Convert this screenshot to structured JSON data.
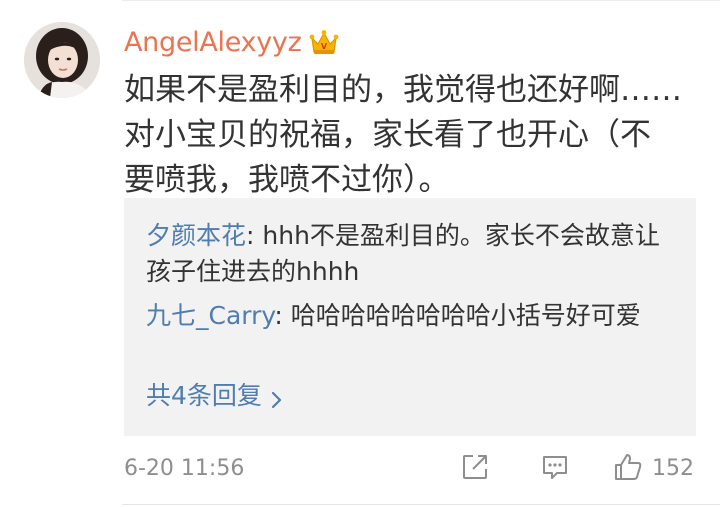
{
  "comment": {
    "username": "AngelAlexyyz",
    "badge_icon": "crown-vip-icon",
    "text": "如果不是盈利目的，我觉得也还好啊……\n对小宝贝的祝福，家长看了也开心（不\n要喷我，我喷不过你）。",
    "timestamp": "6-20 11:56",
    "like_count": "152"
  },
  "replies": [
    {
      "user": "夕颜本花",
      "separator": ": ",
      "text": "hhh不是盈利目的。家长不会故意让孩子住进去的hhhh"
    },
    {
      "user": "九七_Carry",
      "separator": ": ",
      "text": "哈哈哈哈哈哈哈哈小括号好可爱"
    }
  ],
  "more_replies_label": "共4条回复",
  "colors": {
    "username": "#eb7350",
    "link": "#507daf",
    "meta": "#8e8e8e",
    "reply_bg": "#f2f2f2"
  },
  "icons": {
    "share": "share-external-icon",
    "comment": "comment-bubble-icon",
    "like": "thumbs-up-icon",
    "more": "chevron-right-icon"
  }
}
